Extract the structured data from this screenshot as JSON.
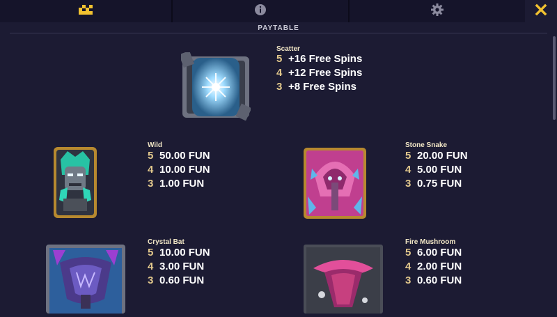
{
  "header": {
    "tabs": [
      {
        "icon": "paytable-icon"
      },
      {
        "icon": "info-icon"
      },
      {
        "icon": "gear-icon"
      }
    ],
    "close_icon": "close-icon",
    "accent": "#f2c230",
    "title": "PAYTABLE"
  },
  "symbols": [
    {
      "name": "Scatter",
      "pays": [
        {
          "count": "5",
          "value": "+16 Free Spins"
        },
        {
          "count": "4",
          "value": "+12 Free Spins"
        },
        {
          "count": "3",
          "value": "+8 Free Spins"
        }
      ]
    },
    {
      "name": "Wild",
      "pays": [
        {
          "count": "5",
          "value": "50.00 FUN"
        },
        {
          "count": "4",
          "value": "10.00 FUN"
        },
        {
          "count": "3",
          "value": "1.00 FUN"
        }
      ]
    },
    {
      "name": "Stone Snake",
      "pays": [
        {
          "count": "5",
          "value": "20.00 FUN"
        },
        {
          "count": "4",
          "value": "5.00 FUN"
        },
        {
          "count": "3",
          "value": "0.75 FUN"
        }
      ]
    },
    {
      "name": "Crystal Bat",
      "pays": [
        {
          "count": "5",
          "value": "10.00 FUN"
        },
        {
          "count": "4",
          "value": "3.00 FUN"
        },
        {
          "count": "3",
          "value": "0.60 FUN"
        }
      ]
    },
    {
      "name": "Fire Mushroom",
      "pays": [
        {
          "count": "5",
          "value": "6.00 FUN"
        },
        {
          "count": "4",
          "value": "2.00 FUN"
        },
        {
          "count": "3",
          "value": "0.60 FUN"
        }
      ]
    }
  ]
}
